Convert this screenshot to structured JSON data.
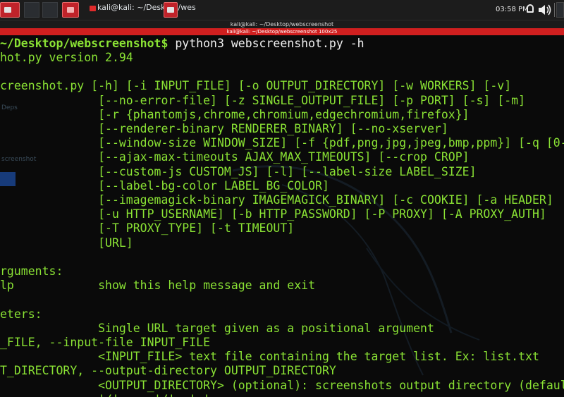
{
  "taskbar": {
    "task_label": "kali@kali: ~/Desktop/wes",
    "clock": "03:58 PM"
  },
  "window": {
    "title": "kali@kali: ~/Desktop/webscreenshot",
    "tab": "kali@kali: ~/Desktop/webscreenshot 100x25"
  },
  "desktop": {
    "ghost_deps": "Deps",
    "ghost_screenshot": "screenshot"
  },
  "terminal": {
    "prompt_path": "~/Desktop/webscreenshot$",
    "prompt_command": " python3 webscreenshot.py -h",
    "lines": [
      "hot.py version 2.94",
      "",
      "creenshot.py [-h] [-i INPUT_FILE] [-o OUTPUT_DIRECTORY] [-w WORKERS] [-v]",
      "              [--no-error-file] [-z SINGLE_OUTPUT_FILE] [-p PORT] [-s] [-m]",
      "              [-r {phantomjs,chrome,chromium,edgechromium,firefox}]",
      "              [--renderer-binary RENDERER_BINARY] [--no-xserver]",
      "              [--window-size WINDOW_SIZE] [-f {pdf,png,jpg,jpeg,bmp,ppm}] [-q [0-",
      "              [--ajax-max-timeouts AJAX_MAX_TIMEOUTS] [--crop CROP]",
      "              [--custom-js CUSTOM_JS] [-l] [--label-size LABEL_SIZE]",
      "              [--label-bg-color LABEL_BG_COLOR]",
      "              [--imagemagick-binary IMAGEMAGICK_BINARY] [-c COOKIE] [-a HEADER]",
      "              [-u HTTP_USERNAME] [-b HTTP_PASSWORD] [-P PROXY] [-A PROXY_AUTH]",
      "              [-T PROXY_TYPE] [-t TIMEOUT]",
      "              [URL]",
      "",
      "rguments:",
      "lp            show this help message and exit",
      "",
      "eters:",
      "              Single URL target given as a positional argument",
      "_FILE, --input-file INPUT_FILE",
      "              <INPUT_FILE> text file containing the target list. Ex: list.txt",
      "T_DIRECTORY, --output-directory OUTPUT_DIRECTORY",
      "              <OUTPUT_DIRECTORY> (optional): screenshots output directory (defaul",
      "              '/'  .  '/'  ' ' "
    ]
  },
  "colors": {
    "terminal_text": "#8ae234",
    "terminal_bg": "#0a0a0a",
    "accent_red": "#d01f1f"
  }
}
